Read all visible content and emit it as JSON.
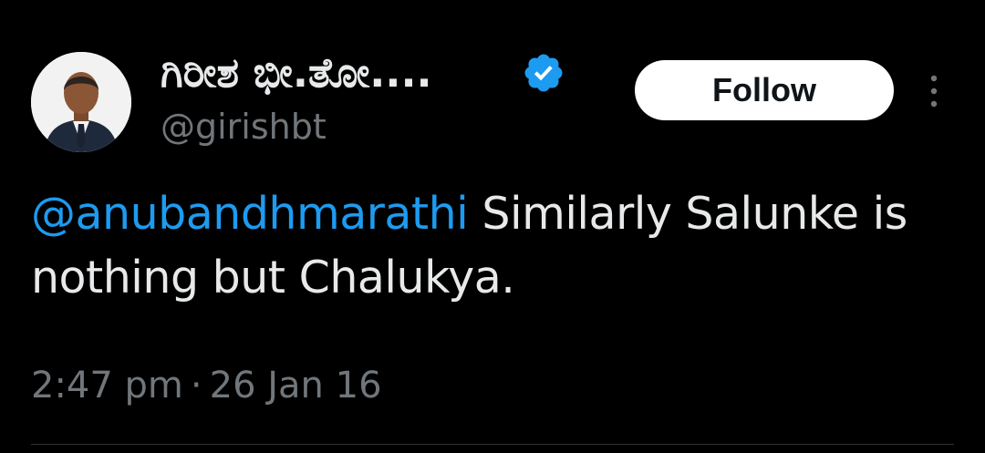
{
  "tweet": {
    "author": {
      "display_name": "ಗಿರೀಶ ಭೀ.ತೋ....",
      "handle": "@girishbt",
      "verified": true,
      "avatar_icon": "profile-photo"
    },
    "follow_label": "Follow",
    "more_icon": "more-vertical-icon",
    "text": {
      "mention": "@anubandhmarathi",
      "body": " Similarly Salunke is nothing but Chalukya."
    },
    "meta": {
      "time": "2:47 pm",
      "separator": "·",
      "date": "26 Jan 16"
    }
  },
  "colors": {
    "background": "#000000",
    "text": "#e7e9ea",
    "secondary_text": "#71767b",
    "link": "#1d9bf0",
    "verified_badge": "#1d9bf0",
    "follow_button_bg": "#ffffff",
    "follow_button_text": "#0f1419"
  }
}
